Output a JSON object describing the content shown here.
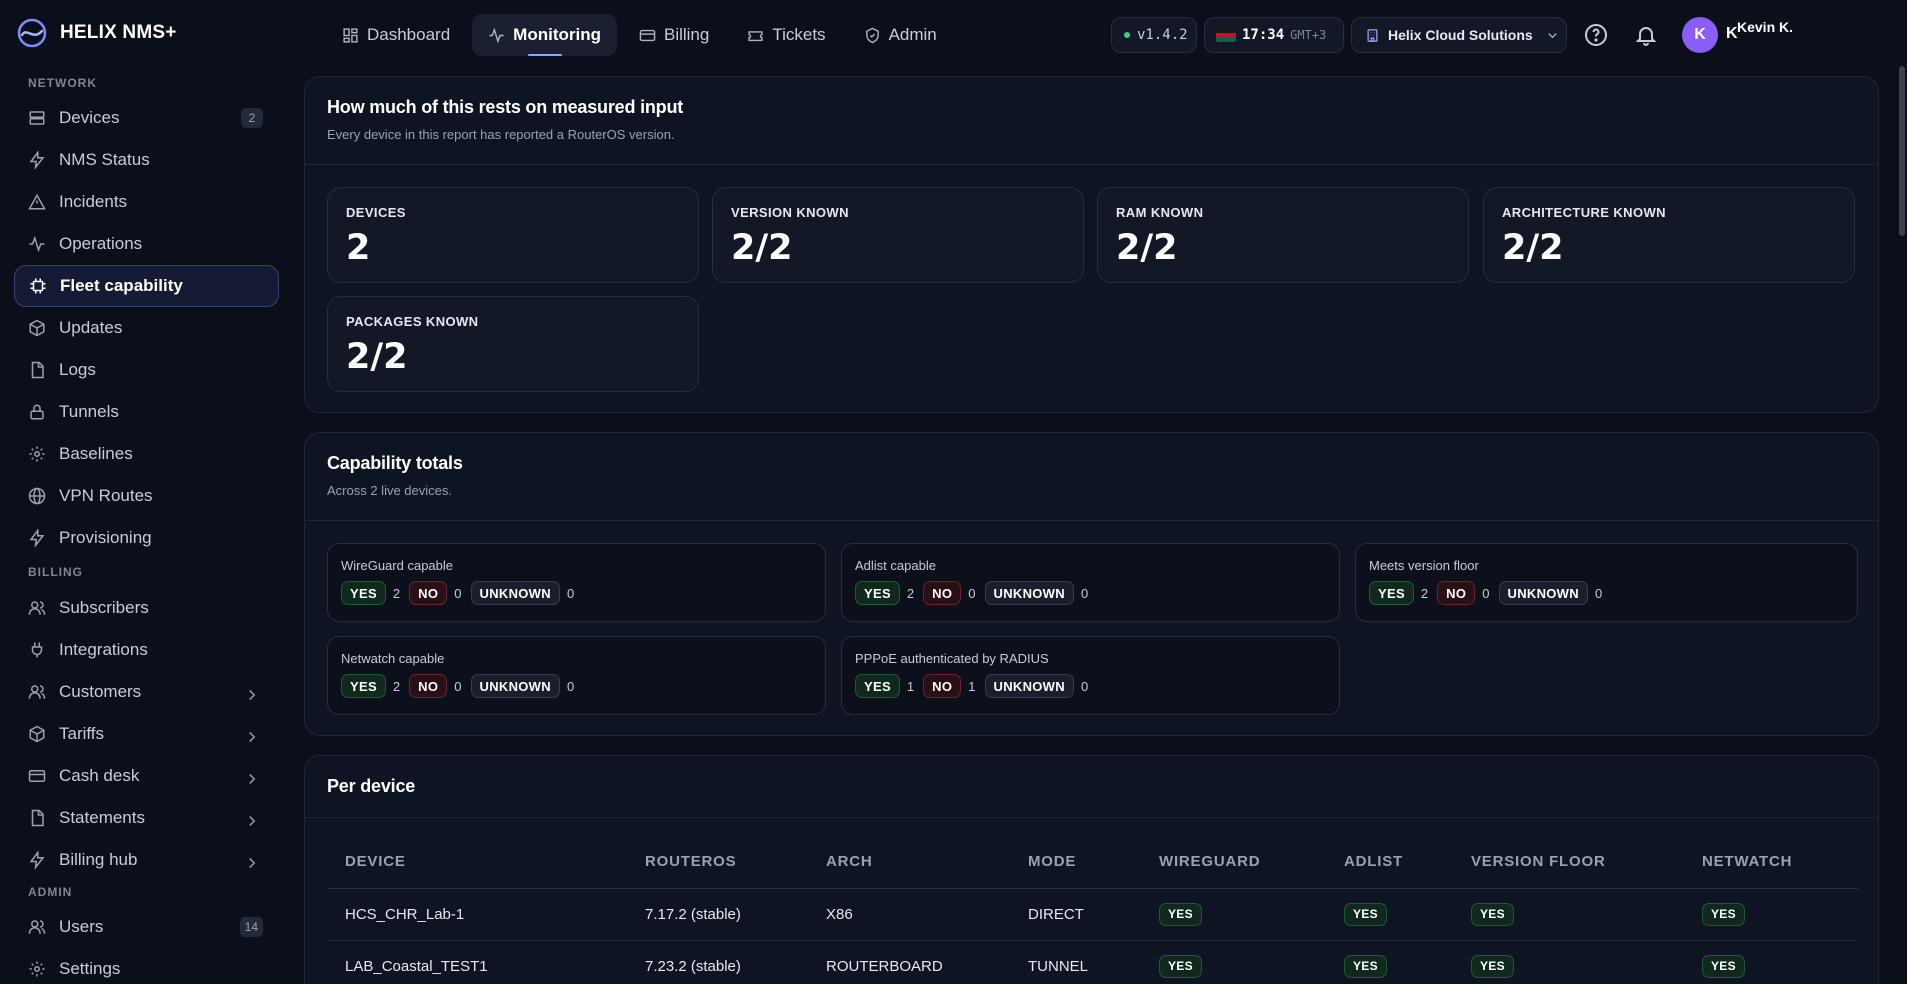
{
  "brand": {
    "name": "HELIX NMS+"
  },
  "nav": {
    "tabs": [
      {
        "label": "Dashboard",
        "icon": "dashboard-icon"
      },
      {
        "label": "Monitoring",
        "icon": "activity-icon",
        "active": true
      },
      {
        "label": "Billing",
        "icon": "card-icon"
      },
      {
        "label": "Tickets",
        "icon": "ticket-icon"
      },
      {
        "label": "Admin",
        "icon": "shield-icon"
      }
    ]
  },
  "topbar": {
    "version": "v1.4.2",
    "time": "17:34",
    "timezone": "GMT+3",
    "organization": "Helix Cloud Solutions",
    "user_initial": "K",
    "user_letter": "K",
    "user_name": "Kevin K."
  },
  "sidebar": {
    "sections": {
      "network": "NETWORK",
      "billing": "BILLING",
      "admin": "ADMIN"
    },
    "items": [
      {
        "label": "Devices",
        "badge": "2"
      },
      {
        "label": "NMS Status"
      },
      {
        "label": "Incidents"
      },
      {
        "label": "Operations"
      },
      {
        "label": "Fleet capability",
        "active": true
      },
      {
        "label": "Updates"
      },
      {
        "label": "Logs"
      },
      {
        "label": "Tunnels"
      },
      {
        "label": "Baselines"
      },
      {
        "label": "VPN Routes"
      },
      {
        "label": "Provisioning"
      },
      {
        "label": "Subscribers"
      },
      {
        "label": "Integrations"
      },
      {
        "label": "Customers"
      },
      {
        "label": "Tariffs"
      },
      {
        "label": "Cash desk"
      },
      {
        "label": "Statements"
      },
      {
        "label": "Billing hub"
      },
      {
        "label": "Users",
        "badge": "14"
      },
      {
        "label": "Settings"
      }
    ]
  },
  "measured": {
    "title": "How much of this rests on measured input",
    "subtitle": "Every device in this report has reported a RouterOS version.",
    "stats": [
      {
        "label": "DEVICES",
        "value": "2"
      },
      {
        "label": "VERSION KNOWN",
        "value": "2/2"
      },
      {
        "label": "RAM KNOWN",
        "value": "2/2"
      },
      {
        "label": "ARCHITECTURE KNOWN",
        "value": "2/2"
      },
      {
        "label": "PACKAGES KNOWN",
        "value": "2/2"
      }
    ]
  },
  "capability": {
    "title": "Capability totals",
    "subtitle": "Across 2 live devices.",
    "labels": {
      "yes": "YES",
      "no": "NO",
      "unknown": "UNKNOWN"
    },
    "items": [
      {
        "label": "WireGuard capable",
        "yes": "2",
        "no": "0",
        "unknown": "0"
      },
      {
        "label": "Adlist capable",
        "yes": "2",
        "no": "0",
        "unknown": "0"
      },
      {
        "label": "Meets version floor",
        "yes": "2",
        "no": "0",
        "unknown": "0"
      },
      {
        "label": "Netwatch capable",
        "yes": "2",
        "no": "0",
        "unknown": "0"
      },
      {
        "label": "PPPoE authenticated by RADIUS",
        "yes": "1",
        "no": "1",
        "unknown": "0"
      }
    ]
  },
  "per_device": {
    "title": "Per device",
    "columns": [
      "DEVICE",
      "ROUTEROS",
      "ARCH",
      "MODE",
      "WIREGUARD",
      "ADLIST",
      "VERSION FLOOR",
      "NETWATCH"
    ],
    "rows": [
      {
        "device": "HCS_CHR_Lab-1",
        "routeros": "7.17.2 (stable)",
        "arch": "X86",
        "mode": "DIRECT",
        "wireguard": "YES",
        "adlist": "YES",
        "version_floor": "YES",
        "netwatch": "YES"
      },
      {
        "device": "LAB_Coastal_TEST1",
        "routeros": "7.23.2 (stable)",
        "arch": "ROUTERBOARD",
        "mode": "TUNNEL",
        "wireguard": "YES",
        "adlist": "YES",
        "version_floor": "YES",
        "netwatch": "YES"
      }
    ]
  },
  "colors": {
    "accent": "#8b5cf6",
    "yes": "#1e5a3a",
    "no": "#6a2231",
    "background": "#0b0f1a"
  }
}
